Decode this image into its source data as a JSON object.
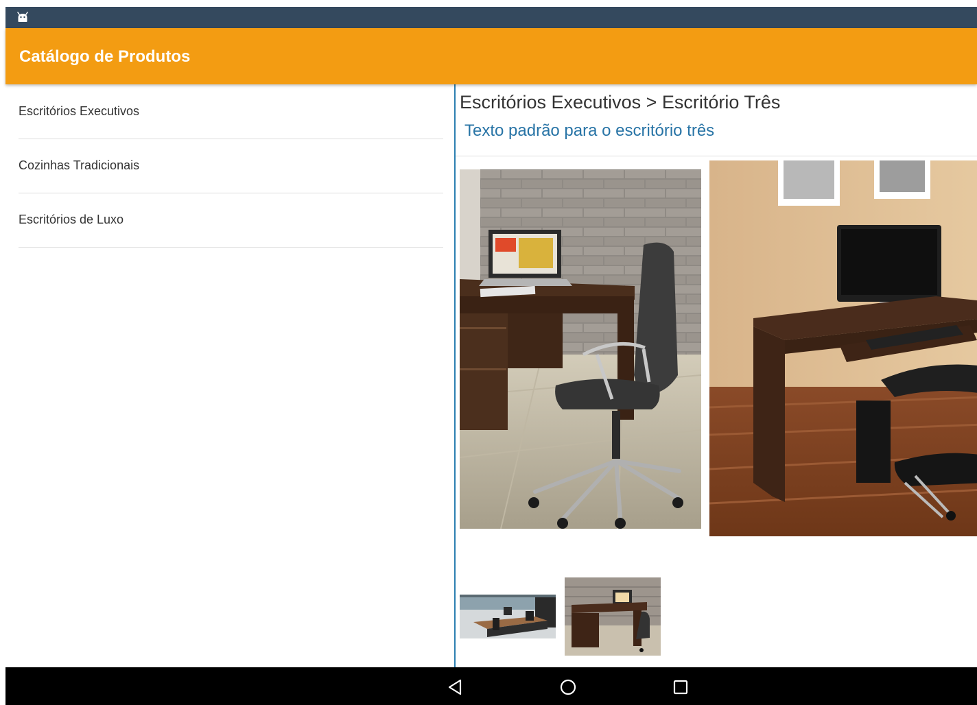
{
  "app": {
    "title": "Catálogo de Produtos"
  },
  "status_bar": {
    "icon": "android-debug-icon",
    "color": "#34495e"
  },
  "theme": {
    "app_bar_color": "#f39c12",
    "accent_color": "#2874a6",
    "divider_color": "#2b7fb0"
  },
  "menu": {
    "items": [
      {
        "label": "Escritórios Executivos"
      },
      {
        "label": "Cozinhas Tradicionais"
      },
      {
        "label": "Escritórios de Luxo"
      }
    ]
  },
  "detail": {
    "breadcrumb": "Escritórios Executivos > Escritório Três",
    "description": "Texto padrão para o escritório três",
    "images": [
      {
        "icon": "office-chair-photo"
      },
      {
        "icon": "office-desk-photo"
      }
    ],
    "thumbnails": [
      {
        "icon": "executive-office-thumbnail"
      },
      {
        "icon": "office-desk-thumbnail"
      }
    ]
  },
  "navigation": {
    "back": "back-icon",
    "home": "home-icon",
    "recents": "recents-icon"
  }
}
